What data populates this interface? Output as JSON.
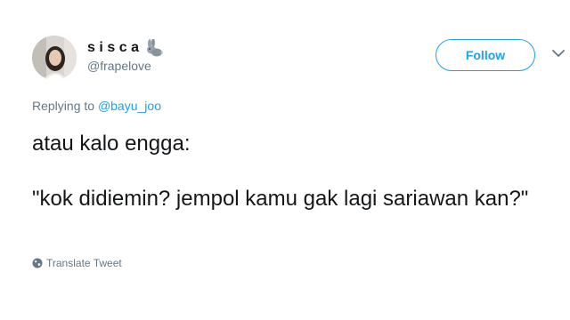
{
  "user": {
    "display_name": "sisca",
    "handle": "@frapelove",
    "name_emoji_icon": "rabbit-icon",
    "avatar_icon": "profile-photo"
  },
  "follow_label": "Follow",
  "reply": {
    "prefix": "Replying to",
    "mention": "@bayu_joo"
  },
  "tweet": {
    "line1": "atau kalo engga:",
    "line2": "\"kok didiemin? jempol kamu gak lagi sariawan kan?\""
  },
  "translate_label": "Translate Tweet",
  "colors": {
    "accent": "#1da1f2",
    "secondary_text": "#657786",
    "primary_text": "#14171a"
  }
}
